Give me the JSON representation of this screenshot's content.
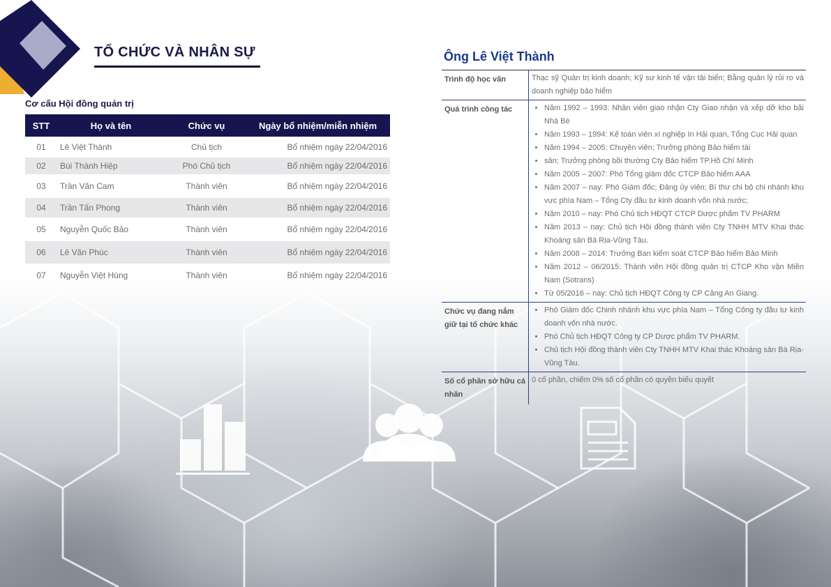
{
  "section_title": "TỔ CHỨC VÀ NHÂN SỰ",
  "board": {
    "label": "Cơ cấu Hội đồng quản trị",
    "headers": [
      "STT",
      "Họ và tên",
      "Chức vụ",
      "Ngày bổ nhiệm/miễn nhiệm"
    ],
    "rows": [
      {
        "stt": "01",
        "name": "Lê Việt Thành",
        "role": "Chủ tịch",
        "date": "Bổ nhiệm ngày 22/04/2016"
      },
      {
        "stt": "02",
        "name": "Bùi Thành Hiệp",
        "role": "Phó Chủ tịch",
        "date": "Bổ nhiệm ngày 22/04/2016"
      },
      {
        "stt": "03",
        "name": "Trần Văn Cam",
        "role": "Thành viên",
        "date": "Bổ nhiệm ngày 22/04/2016"
      },
      {
        "stt": "04",
        "name": "Trần Tấn Phong",
        "role": "Thành viên",
        "date": "Bổ nhiệm ngày 22/04/2016"
      },
      {
        "stt": "05",
        "name": "Nguyễn Quốc Bảo",
        "role": "Thành viên",
        "date": "Bổ nhiệm ngày 22/04/2016"
      },
      {
        "stt": "06",
        "name": "Lê Văn Phúc",
        "role": "Thành viên",
        "date": "Bổ nhiệm ngày 22/04/2016"
      },
      {
        "stt": "07",
        "name": "Nguyễn Việt Hùng",
        "role": "Thành viên",
        "date": "Bổ nhiệm ngày 22/04/2016"
      }
    ]
  },
  "profile": {
    "name": "Ông Lê Việt Thành",
    "education_label": "Trình độ học vấn",
    "education": "Thạc sỹ Quản trị kinh doanh; Kỹ sư kinh tế vận tải biển; Bằng quản lý rủi ro và doanh nghiệp bảo hiểm",
    "career_label": "Quá trình công tác",
    "career": [
      "Năm 1992 – 1993: Nhân viên giao nhận Cty Giao nhận và xếp dỡ kho bãi Nhà Bè",
      "Năm 1993 – 1994: Kế toán viên xí nghiệp In Hải quan, Tổng Cục Hải quan",
      "Năm 1994 – 2005: Chuyên viên; Trưởng phòng Bảo hiểm tài",
      "sản; Trưởng phòng bồi thường Cty Bảo hiểm TP.Hồ Chí Minh",
      "Năm 2005 – 2007: Phó Tổng giám đốc CTCP Bảo hiểm AAA",
      "Năm 2007 – nay: Phó Giám đốc; Đảng ủy viên; Bí thư chi bộ chi nhánh khu vực phía Nam – Tổng Cty đầu tư kinh doanh vốn nhà nước;",
      "Năm 2010 – nay: Phó Chủ tịch HĐQT CTCP Dược phẩm TV PHARM",
      "Năm 2013 – nay: Chủ tịch Hội đồng thành viên Cty TNHH MTV Khai thác Khoáng sản Bà Rịa-Vũng Tàu.",
      "Năm 2008 – 2014: Trưởng Ban kiểm soát CTCP Bảo hiểm Bảo Minh",
      "Năm 2012 – 06/2015: Thành viên Hội đồng quản trị CTCP Kho vận Miền Nam (Sotrans)",
      "Từ 05/2016 – nay: Chủ tịch HĐQT Công ty CP Cảng An Giang."
    ],
    "positions_label": "Chức vụ đang nắm giữ tại tổ chức khác",
    "positions": [
      "Phó Giám đốc Chinh nhánh khu vực phía Nam – Tổng Công ty đầu tư kinh doanh vốn nhà nước.",
      "Phó Chủ tịch HĐQT Công ty CP Dược phẩm TV PHARM.",
      "Chủ tịch Hội đồng thành viên Cty TNHH MTV Khai thác Khoáng sản Bà Rịa-Vũng Tàu."
    ],
    "shares_label": "Số cổ phần sở hữu cá nhân",
    "shares": "0 cổ phần, chiếm 0% số cổ phần có quyền biểu quyết"
  },
  "colors": {
    "navy": "#161550",
    "accent_orange": "#f0ad33",
    "profile_blue": "#1a3a8a",
    "row_shade": "#e7e7e9"
  },
  "icons": [
    "bar-chart-icon",
    "people-group-icon",
    "document-icon"
  ]
}
